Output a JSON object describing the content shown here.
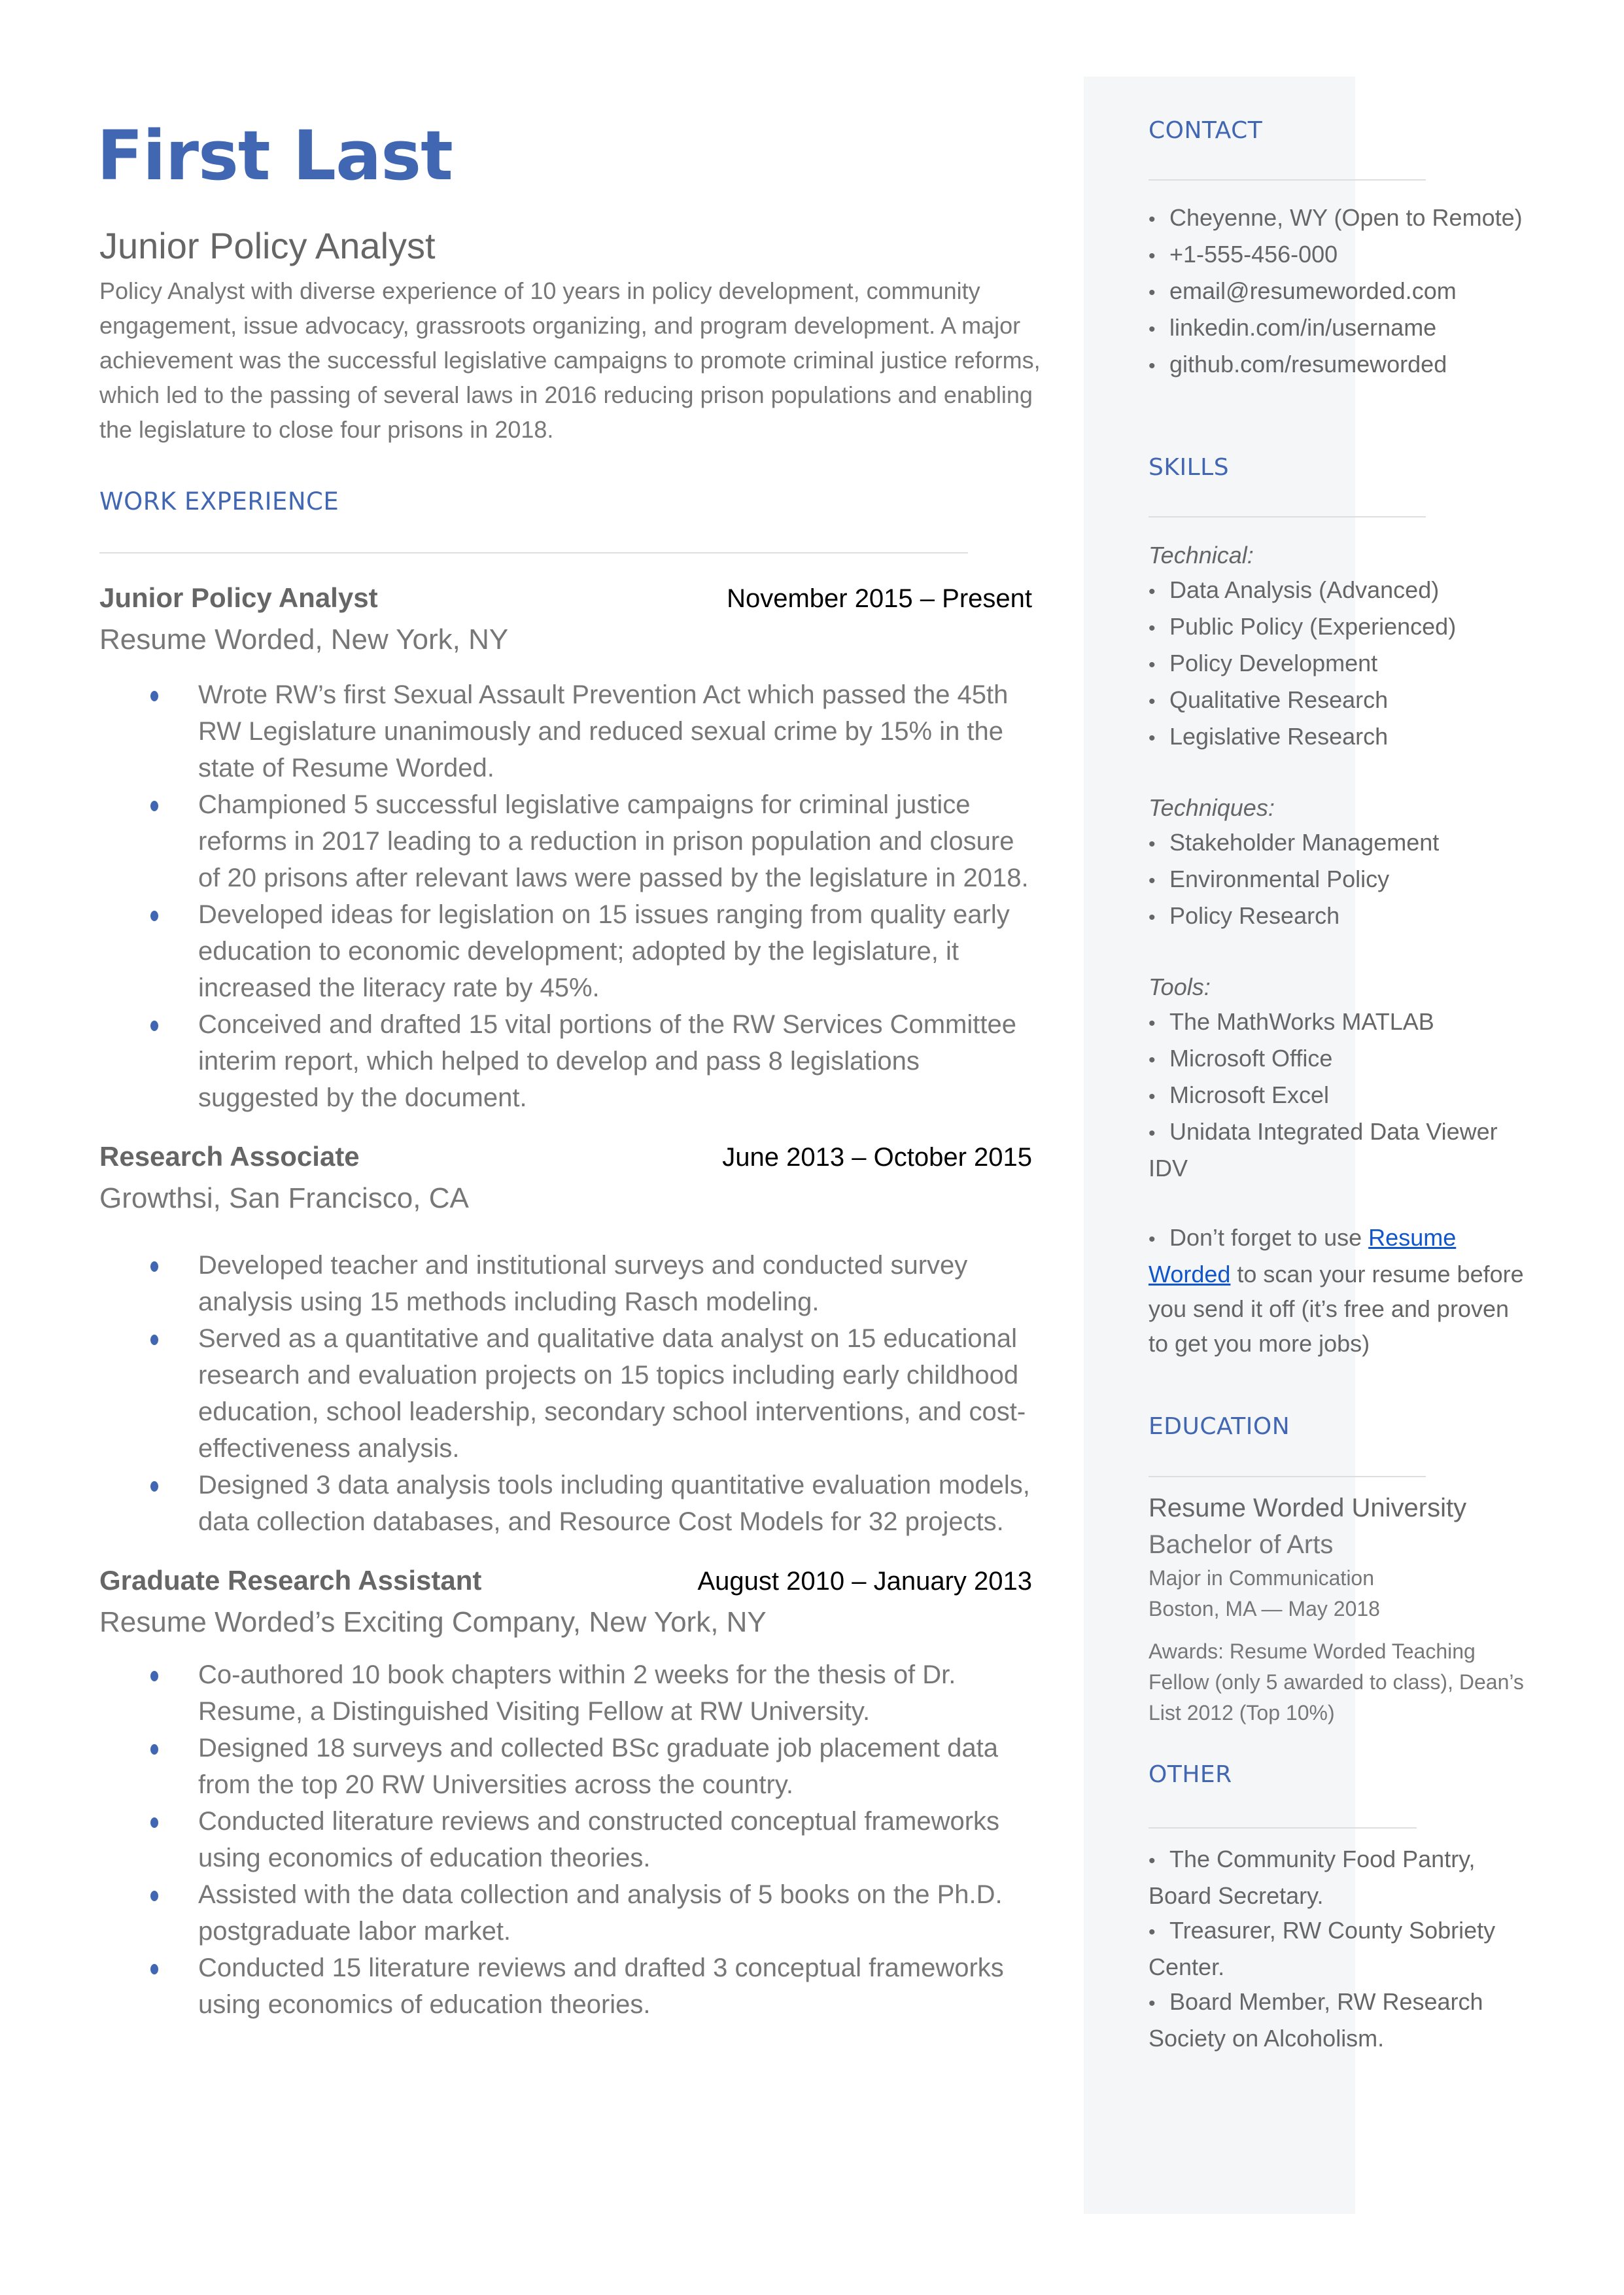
{
  "header": {
    "name": "First Last",
    "title": "Junior Policy Analyst",
    "summary": "Policy Analyst with diverse experience of 10 years in policy development, community engagement, issue advocacy, grassroots organizing, and program development. A major achievement was the successful legislative campaigns to promote criminal justice reforms, which led to the passing of several laws in 2016 reducing prison populations and enabling the legislature to close four prisons in 2018."
  },
  "colors": {
    "accent": "#4267b2",
    "sidebar_bg": "#f5f6f8",
    "body_text": "#666666",
    "link": "#1155cc"
  },
  "work_experience": {
    "heading": "WORK EXPERIENCE",
    "jobs": [
      {
        "role": "Junior Policy Analyst",
        "dates": "November 2015 – Present",
        "company": "Resume Worded, New York, NY",
        "bullets": [
          "Wrote RW’s first Sexual Assault Prevention Act which passed the 45th RW Legislature unanimously and reduced sexual crime by 15% in the state of Resume Worded.",
          "Championed 5 successful legislative campaigns for criminal justice reforms in 2017 leading to a reduction in prison population and closure of 20 prisons after relevant laws were passed by the legislature in 2018.",
          "Developed ideas for legislation on 15 issues ranging from quality early education to economic development; adopted by the legislature, it increased the literacy rate by 45%.",
          "Conceived and drafted 15 vital portions of the RW Services Committee interim report, which helped to develop and pass 8 legislations suggested by the document."
        ]
      },
      {
        "role": "Research Associate",
        "dates": "June 2013 – October 2015",
        "company": "Growthsi, San Francisco, CA",
        "bullets": [
          "Developed teacher and institutional surveys and conducted survey analysis using 15 methods including Rasch modeling.",
          "Served as a quantitative and qualitative data analyst on 15 educational research and evaluation projects on 15 topics including early childhood education, school leadership, secondary school interventions, and cost-effectiveness analysis.",
          "Designed 3 data analysis tools including quantitative evaluation models, data collection databases, and Resource Cost Models for 32 projects."
        ]
      },
      {
        "role": "Graduate Research Assistant",
        "dates": "August 2010 – January 2013",
        "company": "Resume Worded’s Exciting Company, New York, NY",
        "bullets": [
          "Co-authored 10 book chapters within 2 weeks for the thesis of Dr. Resume, a Distinguished Visiting Fellow at RW University.",
          "Designed 18 surveys and collected BSc graduate job placement data from the top 20 RW Universities across the country.",
          "Conducted literature reviews and constructed conceptual frameworks using economics of education theories.",
          "Assisted with the data collection and analysis of 5 books on the Ph.D. postgraduate labor market.",
          "Conducted 15 literature reviews and drafted 3 conceptual frameworks using economics of education theories."
        ]
      }
    ]
  },
  "sidebar": {
    "bullet_glyph": "•",
    "contact": {
      "heading": "CONTACT",
      "items": [
        "Cheyenne, WY (Open to Remote)",
        "+1-555-456-000",
        "email@resumeworded.com",
        "linkedin.com/in/username",
        "github.com/resumeworded"
      ]
    },
    "skills": {
      "heading": "SKILLS",
      "groups": [
        {
          "label": "Technical:",
          "items": [
            "Data Analysis (Advanced)",
            "Public Policy (Experienced)",
            "Policy Development",
            "Qualitative Research",
            "Legislative Research"
          ]
        },
        {
          "label": "Techniques:",
          "items": [
            "Stakeholder Management",
            "Environmental Policy",
            "Policy Research"
          ]
        },
        {
          "label": "Tools:",
          "items": [
            "The MathWorks MATLAB",
            "Microsoft Office",
            "Microsoft Excel",
            "Unidata Integrated Data Viewer IDV"
          ]
        }
      ],
      "tip": {
        "before": "Don’t forget to use ",
        "link": "Resume Worded",
        "after": " to scan your resume before you send it off (it’s free and proven to get you more jobs)"
      }
    },
    "education": {
      "heading": "EDUCATION",
      "school": "Resume Worded University",
      "degree": "Bachelor of Arts",
      "major": "Major in Communication",
      "location_date": "Boston, MA — May 2018",
      "awards": "Awards: Resume Worded Teaching Fellow (only 5 awarded to class), Dean’s List 2012 (Top 10%)"
    },
    "other": {
      "heading": "OTHER",
      "items": [
        "The Community Food Pantry, Board Secretary.",
        "Treasurer, RW County Sobriety Center.",
        "Board Member, RW Research Society on Alcoholism."
      ]
    }
  }
}
